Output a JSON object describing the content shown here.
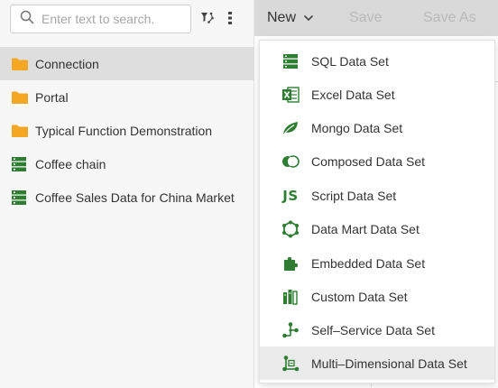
{
  "search": {
    "placeholder": "Enter text to search."
  },
  "tree": {
    "items": [
      {
        "label": "Connection",
        "icon": "folder-icon"
      },
      {
        "label": "Portal",
        "icon": "folder-icon"
      },
      {
        "label": "Typical Function Demonstration",
        "icon": "folder-icon"
      },
      {
        "label": "Coffee chain",
        "icon": "dataset-icon"
      },
      {
        "label": "Coffee Sales Data for China Market",
        "icon": "dataset-icon"
      }
    ]
  },
  "toolbar": {
    "new_label": "New",
    "save_label": "Save",
    "save_as_label": "Save As"
  },
  "menu": {
    "items": [
      {
        "label": "SQL Data Set",
        "icon": "sql-icon"
      },
      {
        "label": "Excel Data Set",
        "icon": "excel-icon"
      },
      {
        "label": "Mongo Data Set",
        "icon": "mongo-leaf-icon"
      },
      {
        "label": "Composed Data Set",
        "icon": "composed-icon"
      },
      {
        "label": "Script Data Set",
        "icon": "js-icon",
        "glyph": "JS"
      },
      {
        "label": "Data Mart Data Set",
        "icon": "data-mart-icon"
      },
      {
        "label": "Embedded Data Set",
        "icon": "puzzle-icon"
      },
      {
        "label": "Custom Data Set",
        "icon": "custom-icon"
      },
      {
        "label": "Self–Service Data Set",
        "icon": "self-service-icon"
      },
      {
        "label": "Multi–Dimensional Data Set",
        "icon": "multi-dimensional-icon"
      }
    ]
  },
  "colors": {
    "accent": "#2e7d32",
    "folder": "#f5a623",
    "toolbar_bg": "#d9d9d9"
  }
}
